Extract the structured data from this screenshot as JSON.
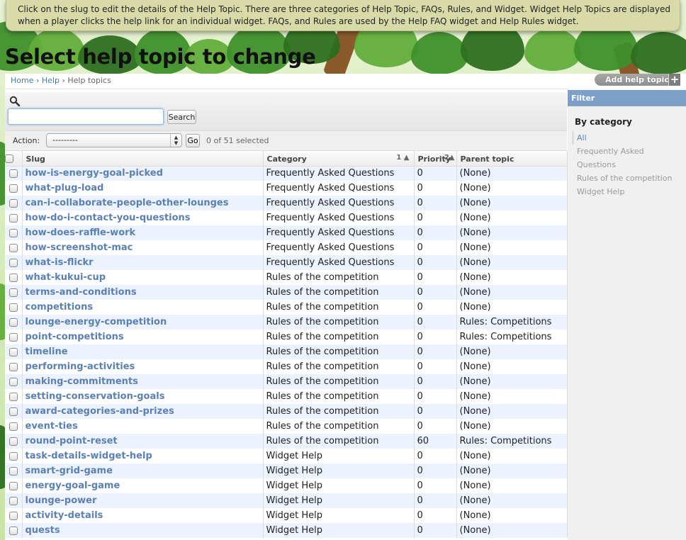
{
  "help_banner": {
    "text": "Click on the slug to edit the details of the Help Topic. There are three categories of Help Topic, FAQs, Rules, and Widget. Widget Help Topics are displayed when a player clicks the help link for an individual widget. FAQs, and Rules are used by the Help FAQ widget and Help Rules widget."
  },
  "page": {
    "title": "Select help topic to change"
  },
  "breadcrumb": {
    "home": "Home",
    "sep1": "›",
    "help": "Help",
    "sep2": "›",
    "current": "Help topics"
  },
  "add_button": {
    "label": "Add help topic",
    "icon": "+"
  },
  "search": {
    "button_label": "Search",
    "value": "",
    "placeholder": ""
  },
  "actions": {
    "label": "Action:",
    "selected": "---------",
    "go_label": "Go",
    "counter": "0 of 51 selected"
  },
  "table": {
    "columns": {
      "slug": "Slug",
      "category": "Category",
      "category_sort": "1 ▲",
      "priority": "Priority",
      "priority_sort": "2▲",
      "parent": "Parent topic"
    },
    "rows": [
      {
        "slug": "how-is-energy-goal-picked",
        "category": "Frequently Asked Questions",
        "priority": "0",
        "parent": "(None)"
      },
      {
        "slug": "what-plug-load",
        "category": "Frequently Asked Questions",
        "priority": "0",
        "parent": "(None)"
      },
      {
        "slug": "can-i-collaborate-people-other-lounges",
        "category": "Frequently Asked Questions",
        "priority": "0",
        "parent": "(None)"
      },
      {
        "slug": "how-do-i-contact-you-questions",
        "category": "Frequently Asked Questions",
        "priority": "0",
        "parent": "(None)"
      },
      {
        "slug": "how-does-raffle-work",
        "category": "Frequently Asked Questions",
        "priority": "0",
        "parent": "(None)"
      },
      {
        "slug": "how-screenshot-mac",
        "category": "Frequently Asked Questions",
        "priority": "0",
        "parent": "(None)"
      },
      {
        "slug": "what-is-flickr",
        "category": "Frequently Asked Questions",
        "priority": "0",
        "parent": "(None)"
      },
      {
        "slug": "what-kukui-cup",
        "category": "Rules of the competition",
        "priority": "0",
        "parent": "(None)"
      },
      {
        "slug": "terms-and-conditions",
        "category": "Rules of the competition",
        "priority": "0",
        "parent": "(None)"
      },
      {
        "slug": "competitions",
        "category": "Rules of the competition",
        "priority": "0",
        "parent": "(None)"
      },
      {
        "slug": "lounge-energy-competition",
        "category": "Rules of the competition",
        "priority": "0",
        "parent": "Rules: Competitions"
      },
      {
        "slug": "point-competitions",
        "category": "Rules of the competition",
        "priority": "0",
        "parent": "Rules: Competitions"
      },
      {
        "slug": "timeline",
        "category": "Rules of the competition",
        "priority": "0",
        "parent": "(None)"
      },
      {
        "slug": "performing-activities",
        "category": "Rules of the competition",
        "priority": "0",
        "parent": "(None)"
      },
      {
        "slug": "making-commitments",
        "category": "Rules of the competition",
        "priority": "0",
        "parent": "(None)"
      },
      {
        "slug": "setting-conservation-goals",
        "category": "Rules of the competition",
        "priority": "0",
        "parent": "(None)"
      },
      {
        "slug": "award-categories-and-prizes",
        "category": "Rules of the competition",
        "priority": "0",
        "parent": "(None)"
      },
      {
        "slug": "event-ties",
        "category": "Rules of the competition",
        "priority": "0",
        "parent": "(None)"
      },
      {
        "slug": "round-point-reset",
        "category": "Rules of the competition",
        "priority": "60",
        "parent": "Rules: Competitions"
      },
      {
        "slug": "task-details-widget-help",
        "category": "Widget Help",
        "priority": "0",
        "parent": "(None)"
      },
      {
        "slug": "smart-grid-game",
        "category": "Widget Help",
        "priority": "0",
        "parent": "(None)"
      },
      {
        "slug": "energy-goal-game",
        "category": "Widget Help",
        "priority": "0",
        "parent": "(None)"
      },
      {
        "slug": "lounge-power",
        "category": "Widget Help",
        "priority": "0",
        "parent": "(None)"
      },
      {
        "slug": "activity-details",
        "category": "Widget Help",
        "priority": "0",
        "parent": "(None)"
      },
      {
        "slug": "quests",
        "category": "Widget Help",
        "priority": "0",
        "parent": "(None)"
      }
    ]
  },
  "filter": {
    "title": "Filter",
    "heading": "By category",
    "items": [
      {
        "label": "All",
        "selected": true
      },
      {
        "label": "Frequently Asked Questions",
        "selected": false
      },
      {
        "label": "Rules of the competition",
        "selected": false
      },
      {
        "label": "Widget Help",
        "selected": false
      }
    ]
  },
  "icons": {
    "search": "search-icon",
    "add": "plus-icon",
    "select_arrows": "select-arrows-icon"
  },
  "colors": {
    "link": "#5b80b2",
    "filter_header": "#7ca0c7",
    "row_alt": "#edf3fe"
  }
}
